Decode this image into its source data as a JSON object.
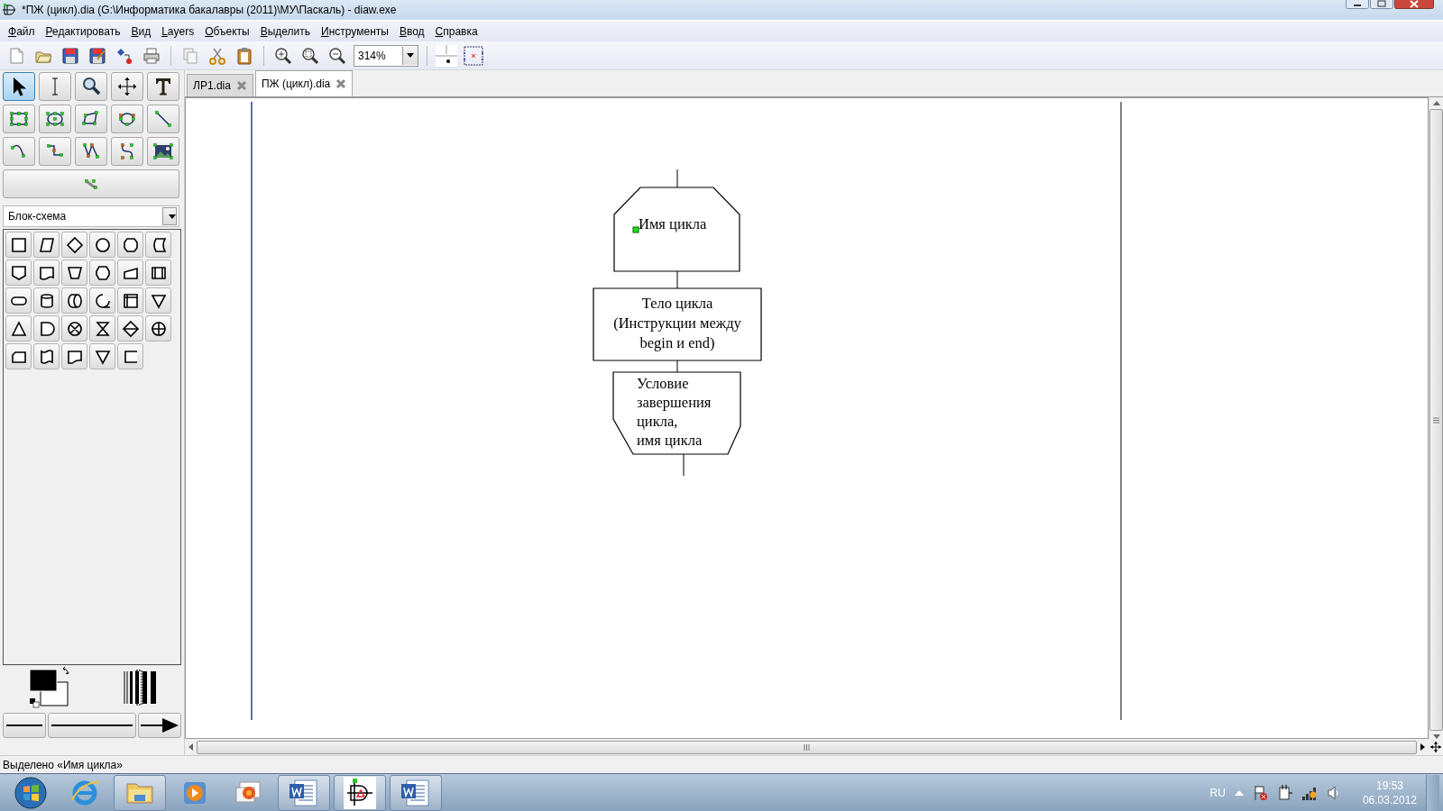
{
  "window": {
    "title": "*ПЖ (цикл).dia (G:\\Информатика бакалавры (2011)\\МУ\\Паскаль) - diaw.exe"
  },
  "menu": [
    "Файл",
    "Редактировать",
    "Вид",
    "Layers",
    "Объекты",
    "Выделить",
    "Инструменты",
    "Ввод",
    "Справка"
  ],
  "toolbar": {
    "zoom": "314%"
  },
  "tools": [
    {
      "kind": "pointer",
      "selected": true
    },
    {
      "kind": "text-cursor",
      "selected": false
    },
    {
      "kind": "magnifier",
      "selected": false
    },
    {
      "kind": "move",
      "selected": false
    },
    {
      "kind": "text",
      "selected": false
    },
    {
      "kind": "box",
      "selected": false
    },
    {
      "kind": "ellipse",
      "selected": false
    },
    {
      "kind": "polygon",
      "selected": false
    },
    {
      "kind": "beziergon",
      "selected": false
    },
    {
      "kind": "line",
      "selected": false
    },
    {
      "kind": "arc",
      "selected": false
    },
    {
      "kind": "zigzag",
      "selected": false
    },
    {
      "kind": "polyline",
      "selected": false
    },
    {
      "kind": "bezier",
      "selected": false
    },
    {
      "kind": "image",
      "selected": false
    },
    {
      "kind": "outline",
      "selected": false
    }
  ],
  "sheet_selector": {
    "value": "Блок-схема"
  },
  "tabs": [
    {
      "label": "ЛР1.dia",
      "selected": false
    },
    {
      "label": "ПЖ (цикл).dia",
      "selected": true
    }
  ],
  "diagram": {
    "shapes": [
      {
        "kind": "loop-start",
        "text": "Имя цикла",
        "selected": true
      },
      {
        "kind": "process",
        "text": "Тело цикла\n(Инструкции между\nbegin и end)",
        "selected": false
      },
      {
        "kind": "loop-end",
        "text": "Условие\nзавершения\nцикла,\nимя цикла",
        "selected": false
      }
    ]
  },
  "status_bar": "Выделено «Имя цикла»",
  "taskbar": {
    "language": "RU",
    "time": "19:53",
    "date": "06.03.2012"
  }
}
